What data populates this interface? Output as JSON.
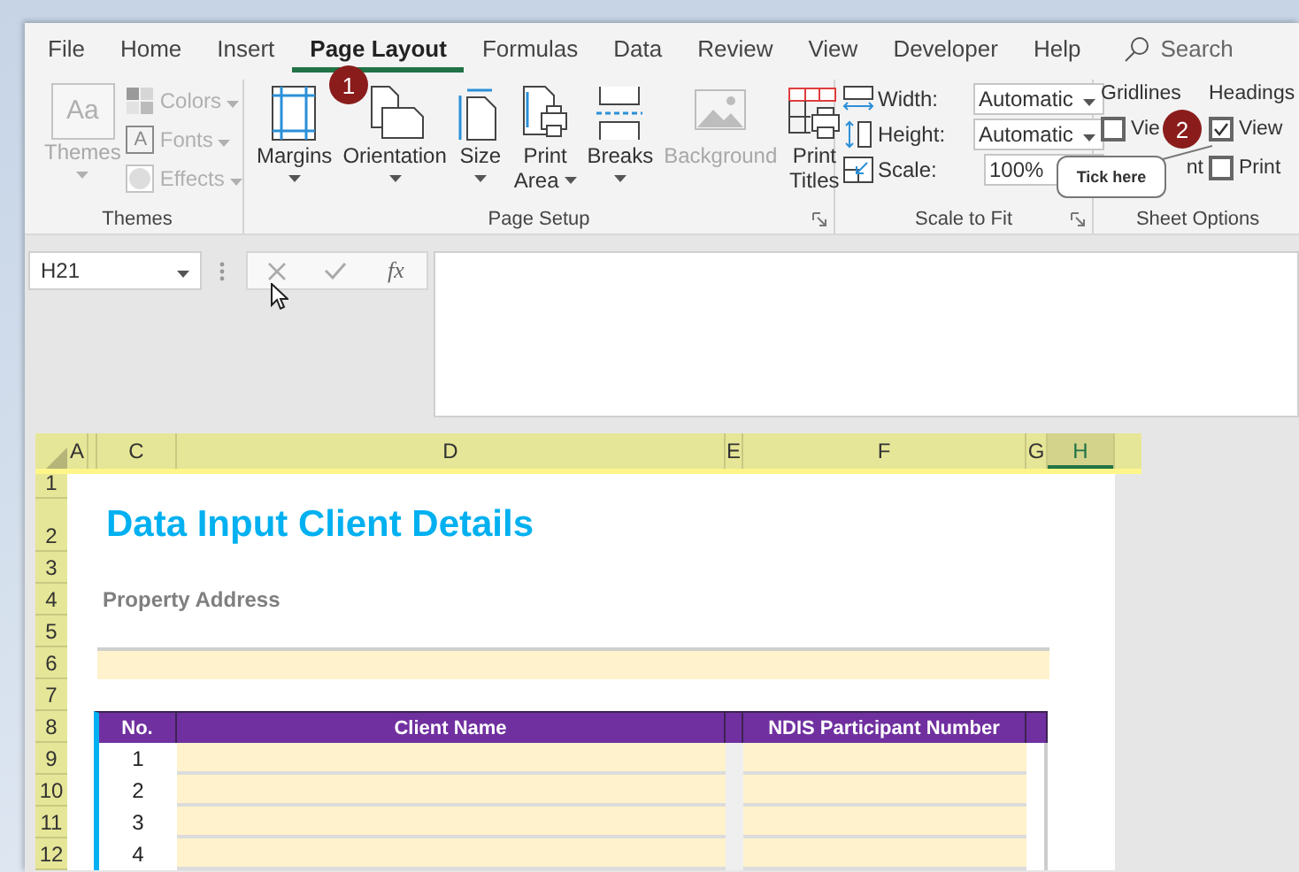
{
  "tabs": [
    {
      "label": "File",
      "selected": false
    },
    {
      "label": "Home",
      "selected": false
    },
    {
      "label": "Insert",
      "selected": false
    },
    {
      "label": "Page Layout",
      "selected": true
    },
    {
      "label": "Formulas",
      "selected": false
    },
    {
      "label": "Data",
      "selected": false
    },
    {
      "label": "Review",
      "selected": false
    },
    {
      "label": "View",
      "selected": false
    },
    {
      "label": "Developer",
      "selected": false
    },
    {
      "label": "Help",
      "selected": false
    }
  ],
  "search": {
    "placeholder": "Search"
  },
  "themes_group": {
    "label": "Themes",
    "big": {
      "label": "Themes",
      "icon_text": "Aa",
      "disabled": true
    },
    "items": [
      {
        "kind": "colors",
        "label": "Colors",
        "disabled": true
      },
      {
        "kind": "fonts",
        "label": "Fonts",
        "icon_text": "A",
        "disabled": true
      },
      {
        "kind": "effects",
        "label": "Effects",
        "disabled": true
      }
    ]
  },
  "page_setup": {
    "label": "Page Setup",
    "buttons": [
      {
        "kind": "margins",
        "lines": [
          "Margins"
        ],
        "dropdown": true,
        "disabled": false
      },
      {
        "kind": "orientation",
        "lines": [
          "Orientation"
        ],
        "dropdown": true,
        "disabled": false
      },
      {
        "kind": "size",
        "lines": [
          "Size"
        ],
        "dropdown": true,
        "disabled": false
      },
      {
        "kind": "print_area",
        "lines": [
          "Print",
          "Area"
        ],
        "dropdown": true,
        "disabled": false
      },
      {
        "kind": "breaks",
        "lines": [
          "Breaks"
        ],
        "dropdown": true,
        "disabled": false
      },
      {
        "kind": "background",
        "lines": [
          "Background"
        ],
        "dropdown": false,
        "disabled": true
      },
      {
        "kind": "print_titles",
        "lines": [
          "Print",
          "Titles"
        ],
        "dropdown": false,
        "disabled": false
      }
    ]
  },
  "scale_to_fit": {
    "label": "Scale to Fit",
    "rows": [
      {
        "kind": "width",
        "label": "Width:",
        "value": "Automatic"
      },
      {
        "kind": "height",
        "label": "Height:",
        "value": "Automatic"
      },
      {
        "kind": "scale",
        "label": "Scale:",
        "value": "100%"
      }
    ]
  },
  "sheet_options": {
    "label": "Sheet Options",
    "columns": [
      {
        "heading": "Gridlines",
        "items": [
          {
            "kind": "checkbox",
            "label": "Vie",
            "checked": false
          },
          {
            "kind": "text",
            "label": "nt"
          }
        ]
      },
      {
        "heading": "Headings",
        "items": [
          {
            "kind": "checkbox",
            "label": "View",
            "checked": true
          },
          {
            "kind": "checkbox",
            "label": "Print",
            "checked": false
          }
        ]
      }
    ]
  },
  "formula_bar": {
    "name_box": "H21",
    "function_label": "fx"
  },
  "sheet": {
    "columns": [
      {
        "label": "A",
        "selected": false
      },
      {
        "selected": false
      },
      {
        "label": "C",
        "selected": false
      },
      {
        "label": "D",
        "selected": false
      },
      {
        "label": "E",
        "selected": false
      },
      {
        "label": "F",
        "selected": false
      },
      {
        "label": "G",
        "selected": false
      },
      {
        "label": "H",
        "selected": true
      }
    ],
    "row_headers": [
      "1",
      "2",
      "3",
      "4",
      "5",
      "6",
      "7",
      "8",
      "9",
      "10",
      "11",
      "12"
    ],
    "title": "Data Input Client Details",
    "property_label": "Property Address",
    "table": {
      "columns": [
        "No.",
        "Client Name",
        "NDIS Participant Number"
      ],
      "rows": [
        "1",
        "2",
        "3",
        "4"
      ]
    }
  },
  "callouts": [
    {
      "label": "1"
    },
    {
      "label": "2"
    }
  ],
  "tooltip": "Tick here"
}
